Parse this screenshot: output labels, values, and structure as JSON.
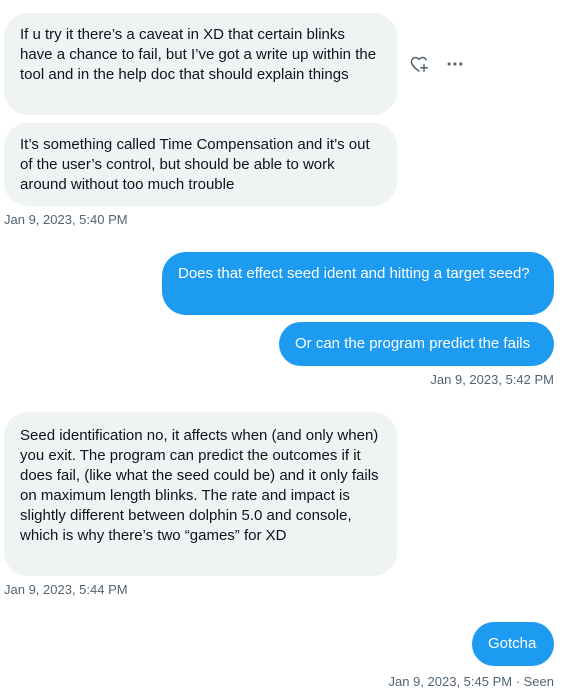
{
  "messages": [
    {
      "text": "If u try it there’s a caveat in XD that certain blinks have a chance to fail, but I’ve got a write up within the tool and in the help doc that should explain things"
    },
    {
      "text": "It’s something called Time Compensation and it’s out of the user’s control, but should be able to work around without too much trouble"
    },
    {
      "text": "Does that effect seed ident and hitting a target seed?"
    },
    {
      "text": "Or can the program predict the fails"
    },
    {
      "text": "Seed identification no, it affects when (and only when) you exit. The program can predict the outcomes if it does fail, (like what the seed could be) and it only fails on maximum length blinks. The rate and impact is slightly different between dolphin 5.0 and console, which is why there’s two “games” for XD"
    },
    {
      "text": "Gotcha"
    }
  ],
  "timestamps": [
    "Jan 9, 2023, 5:40 PM",
    "Jan 9, 2023, 5:42 PM",
    "Jan 9, 2023, 5:44 PM",
    "Jan 9, 2023, 5:45 PM · Seen"
  ],
  "icons": {
    "react": "heart-plus-icon",
    "more": "more-icon"
  },
  "colors": {
    "sent_bubble": "#1d9bf0",
    "received_bubble": "#eff3f4",
    "text": "#0f1419",
    "meta": "#536471"
  }
}
